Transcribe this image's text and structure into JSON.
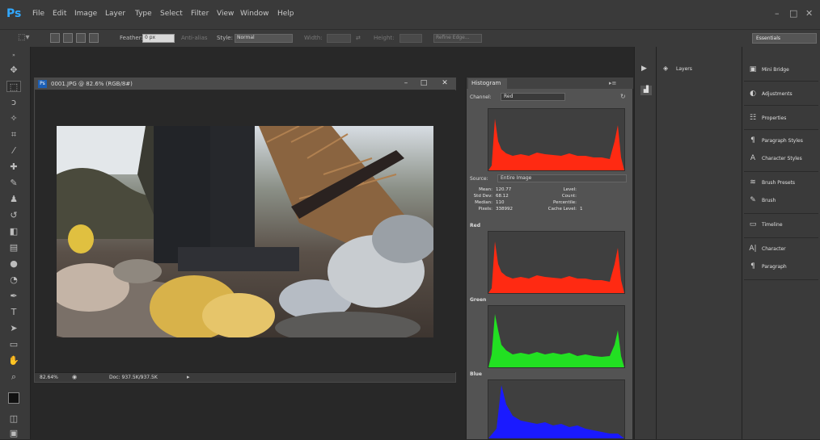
{
  "app": {
    "logo": "Ps"
  },
  "menu": [
    "File",
    "Edit",
    "Image",
    "Layer",
    "Type",
    "Select",
    "Filter",
    "View",
    "Window",
    "Help"
  ],
  "window_controls": {
    "minimize": "–",
    "restore": "□",
    "close": "✕"
  },
  "options": {
    "feather_label": "Feather:",
    "feather_value": "0 px",
    "antialias_label": "Anti-alias",
    "style_label": "Style:",
    "style_value": "Normal",
    "width_label": "Width:",
    "height_label": "Height:",
    "refine_label": "Refine Edge...",
    "workspace": "Essentials"
  },
  "document": {
    "title": "0001.JPG @ 82.6% (RGB/8#)",
    "ps_badge": "Ps",
    "zoom": "82.64%",
    "doc_size": "Doc: 937.5K/937.5K"
  },
  "histogram": {
    "tab": "Histogram",
    "channel_label": "Channel:",
    "channel_value": "Red",
    "source_label": "Source:",
    "source_value": "Entire Image",
    "stats": {
      "mean_label": "Mean:",
      "mean": "120.77",
      "stddev_label": "Std Dev:",
      "stddev": "68.12",
      "median_label": "Median:",
      "median": "110",
      "pixels_label": "Pixels:",
      "pixels": "338992",
      "level_label": "Level:",
      "level": "",
      "count_label": "Count:",
      "count": "",
      "percentile_label": "Percentile:",
      "percentile": "",
      "cache_label": "Cache Level:",
      "cache": "1"
    },
    "channels": [
      {
        "name": "Red",
        "color": "#ff2a12"
      },
      {
        "name": "Green",
        "color": "#22e022"
      },
      {
        "name": "Blue",
        "color": "#1a1aff"
      }
    ],
    "main_color": "#ff2a12"
  },
  "layers_panel": {
    "label": "Layers"
  },
  "right_panel": [
    {
      "icon": "bridge-icon",
      "glyph": "▣",
      "label": "Mini Bridge"
    },
    {
      "icon": "adjustments-icon",
      "glyph": "◐",
      "label": "Adjustments"
    },
    {
      "icon": "properties-icon",
      "glyph": "☷",
      "label": "Properties"
    },
    {
      "icon": "paragraph-styles-icon",
      "glyph": "¶",
      "label": "Paragraph Styles"
    },
    {
      "icon": "character-styles-icon",
      "glyph": "A",
      "label": "Character Styles"
    },
    {
      "icon": "brush-presets-icon",
      "glyph": "≋",
      "label": "Brush Presets"
    },
    {
      "icon": "brush-icon",
      "glyph": "✎",
      "label": "Brush"
    },
    {
      "icon": "timeline-icon",
      "glyph": "▭",
      "label": "Timeline"
    },
    {
      "icon": "character-icon",
      "glyph": "A|",
      "label": "Character"
    },
    {
      "icon": "paragraph-icon",
      "glyph": "¶",
      "label": "Paragraph"
    }
  ]
}
